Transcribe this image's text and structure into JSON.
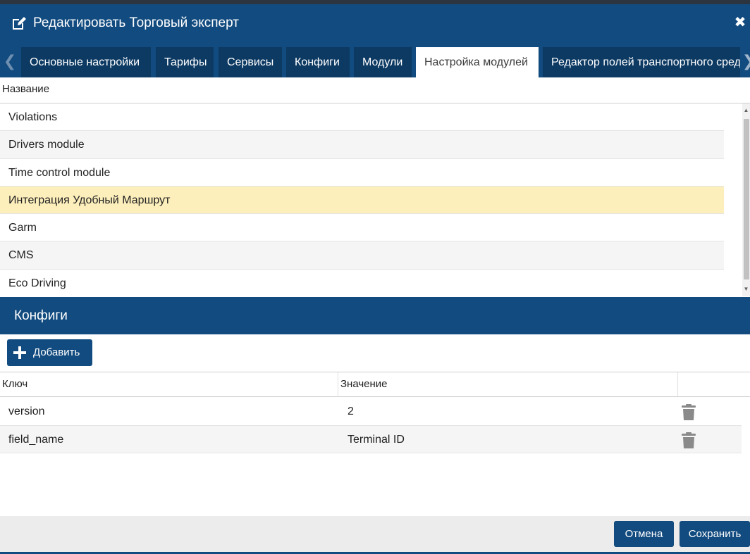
{
  "dialog": {
    "title": "Редактировать Торговый эксперт",
    "icons": {
      "title": "edit-icon",
      "close": "close-icon"
    }
  },
  "tabs": [
    {
      "label": "Основные настройки",
      "active": false
    },
    {
      "label": "Тарифы",
      "active": false
    },
    {
      "label": "Сервисы",
      "active": false
    },
    {
      "label": "Конфиги",
      "active": false
    },
    {
      "label": "Модули",
      "active": false
    },
    {
      "label": "Настройка модулей",
      "active": true
    },
    {
      "label": "Редактор полей транспортного средства",
      "active": false
    }
  ],
  "modules": {
    "header": "Название",
    "items": [
      {
        "name": "Violations"
      },
      {
        "name": "Drivers module"
      },
      {
        "name": "Time control module"
      },
      {
        "name": "Интеграция Удобный Маршрут",
        "selected": true
      },
      {
        "name": "Garm"
      },
      {
        "name": "CMS"
      },
      {
        "name": "Eco Driving"
      }
    ]
  },
  "configs": {
    "section_title": "Конфиги",
    "add_label": "Добавить",
    "columns": {
      "key": "Ключ",
      "value": "Значение"
    },
    "rows": [
      {
        "key": "version",
        "value": "2"
      },
      {
        "key": "field_name",
        "value": "Terminal ID"
      }
    ]
  },
  "footer": {
    "cancel_label": "Отмена",
    "save_label": "Сохранить"
  },
  "colors": {
    "primary": "#124b7f",
    "tab_inactive": "#0d3a63",
    "selected_row": "#fdefbc",
    "footer_bg": "#ececec"
  }
}
